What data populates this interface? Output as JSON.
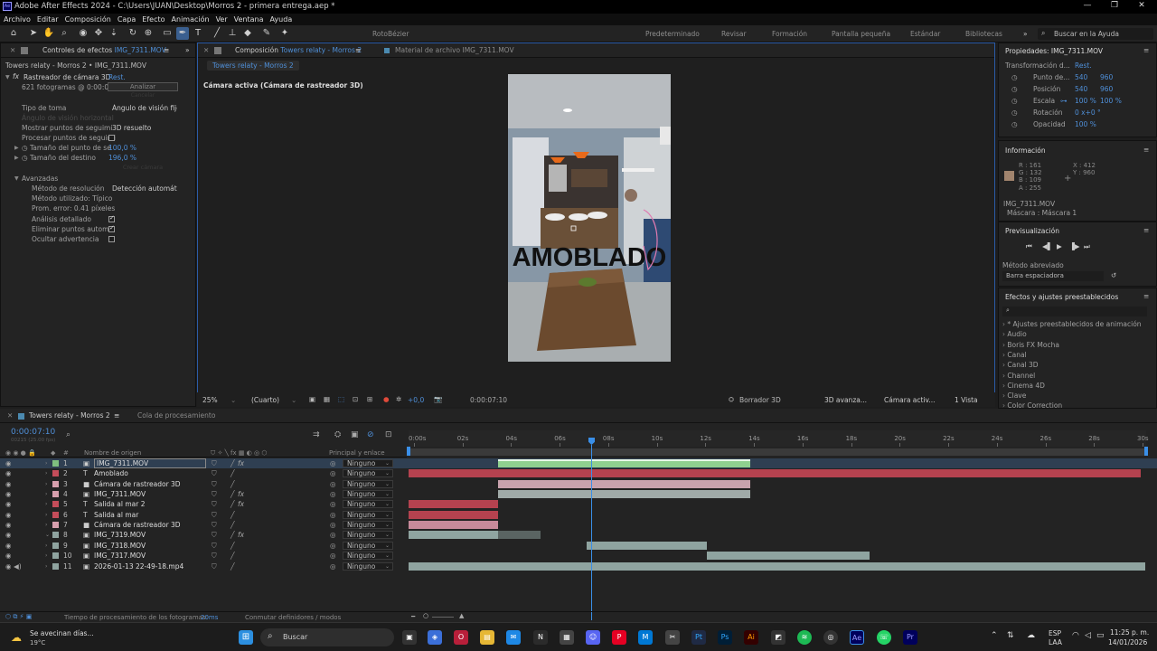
{
  "titlebar": {
    "title": "Adobe After Effects 2024 - C:\\Users\\JUAN\\Desktop\\Morros 2 - primera entrega.aep *",
    "minimize": "—",
    "maximize": "❐",
    "close": "✕"
  },
  "menu": [
    "Archivo",
    "Editar",
    "Composición",
    "Capa",
    "Efecto",
    "Animación",
    "Ver",
    "Ventana",
    "Ayuda"
  ],
  "toolbar": {
    "rotobezier": "RotoBézier",
    "workspaces": [
      "Predeterminado",
      "Revisar",
      "Formación",
      "Pantalla pequeña",
      "Estándar",
      "Bibliotecas"
    ],
    "search_placeholder": "Buscar en la Ayuda"
  },
  "effects_panel": {
    "tab_label": "Controles de efectos",
    "tab_file": "IMG_7311.MOV",
    "layer_path": "Towers relaty - Morros 2 • IMG_7311.MOV",
    "effect_name": "Rastreador de cámara 3D",
    "reset": "Rest.",
    "frames": "621 fotogramas @ 0:00:00:",
    "analyze": "Analizar",
    "cancel": "Cancelar",
    "shot_type_label": "Tipo de toma",
    "shot_type_value": "Ángulo de visión fijo",
    "fov_label": "Ángulo de visión horizontal",
    "show_track_label": "Mostrar puntos de seguimi",
    "show_track_value": "3D resuelto",
    "process_label": "Procesar puntos de seguimi",
    "track_size_label": "Tamaño del punto de se",
    "track_size_value": "100,0 %",
    "target_size_label": "Tamaño del destino",
    "target_size_value": "196,0 %",
    "create_camera": "Crear cámara",
    "advanced": "Avanzadas",
    "solve_method_label": "Método de resolución",
    "solve_method_value": "Detección automática",
    "method_used": "Método utilizado: Típico",
    "avg_error": "Prom. error: 0.41 píxeles",
    "detailed_label": "Análisis detallado",
    "auto_delete_label": "Eliminar puntos autom.",
    "hide_warning_label": "Ocultar advertencia"
  },
  "comp_panel": {
    "tab_label": "Composición",
    "tab_comp": "Towers relaty - Morros 2",
    "footage_tab": "Material de archivo IMG_7311.MOV",
    "breadcrumb": "Towers relaty - Morros 2",
    "camera_label": "Cámara activa (Cámara de rastreador 3D)",
    "overlay_text": "AMOBLADO",
    "zoom": "25%",
    "resolution": "(Cuarto)",
    "exposure": "+0,0",
    "timecode": "0:00:07:10",
    "draft": "Borrador 3D",
    "renderer": "3D avanza...",
    "camera": "Cámara activ...",
    "views": "1 Vista"
  },
  "properties": {
    "title": "Propiedades: IMG_7311.MOV",
    "transform": "Transformación d...",
    "reset": "Rest.",
    "rows": [
      {
        "label": "Punto de...",
        "v1": "540",
        "v2": "960"
      },
      {
        "label": "Posición",
        "v1": "540",
        "v2": "960"
      },
      {
        "label": "Escala",
        "v1": "100 %",
        "v2": "100 %"
      },
      {
        "label": "Rotación",
        "v1": "0 x+0 °",
        "v2": ""
      },
      {
        "label": "Opacidad",
        "v1": "100 %",
        "v2": ""
      }
    ]
  },
  "info": {
    "title": "Información",
    "r": "R : 161",
    "g": "G : 132",
    "b": "B : 109",
    "a": "A : 255",
    "x": "X : 412",
    "y": "Y : 960",
    "swatch": "#a1846d",
    "file": "IMG_7311.MOV",
    "mask": "Máscara : Máscara 1"
  },
  "preview": {
    "title": "Previsualización",
    "method_label": "Método abreviado",
    "method_value": "Barra espaciadora"
  },
  "presets": {
    "title": "Efectos y ajustes preestablecidos",
    "items": [
      "* Ajustes preestablecidos de animación",
      "Audio",
      "Boris FX Mocha",
      "Canal",
      "Canal 3D",
      "Channel",
      "Cinema 4D",
      "Clave",
      "Color Correction"
    ]
  },
  "timeline": {
    "tab_label": "Towers relaty - Morros 2",
    "queue_tab": "Cola de procesamiento",
    "timecode": "0:00:07:10",
    "fps": "00215 (25.00 fps)",
    "col_source": "Nombre de origen",
    "col_parent": "Principal y enlace",
    "col_num": "#",
    "ruler": [
      "0:00s",
      "02s",
      "04s",
      "06s",
      "08s",
      "10s",
      "12s",
      "14s",
      "16s",
      "18s",
      "20s",
      "22s",
      "24s",
      "26s",
      "28s",
      "30s"
    ],
    "layers": [
      {
        "num": "1",
        "icon": "▣",
        "name": "IMG_7311.MOV",
        "color": "#7fbf7f",
        "parent": "Ninguno",
        "fx": "fx"
      },
      {
        "num": "2",
        "icon": "T",
        "name": "Amoblado",
        "color": "#c44d5a",
        "parent": "Ninguno",
        "fx": ""
      },
      {
        "num": "3",
        "icon": "■",
        "name": "Cámara de rastreador 3D",
        "color": "#d7a0ae",
        "parent": "Ninguno",
        "fx": ""
      },
      {
        "num": "4",
        "icon": "▣",
        "name": "IMG_7311.MOV",
        "color": "#d7a0ae",
        "parent": "Ninguno",
        "fx": "fx"
      },
      {
        "num": "5",
        "icon": "T",
        "name": "Salida al mar 2",
        "color": "#c44d5a",
        "parent": "Ninguno",
        "fx": "fx"
      },
      {
        "num": "6",
        "icon": "T",
        "name": "Salida al mar",
        "color": "#c44d5a",
        "parent": "Ninguno",
        "fx": ""
      },
      {
        "num": "7",
        "icon": "■",
        "name": "Cámara de rastreador 3D",
        "color": "#d7a0ae",
        "parent": "Ninguno",
        "fx": ""
      },
      {
        "num": "8",
        "icon": "▣",
        "name": "IMG_7319.MOV",
        "color": "#8fa4a0",
        "parent": "Ninguno",
        "fx": "fx"
      },
      {
        "num": "9",
        "icon": "▣",
        "name": "IMG_7318.MOV",
        "color": "#8fa4a0",
        "parent": "Ninguno",
        "fx": ""
      },
      {
        "num": "10",
        "icon": "▣",
        "name": "IMG_7317.MOV",
        "color": "#8fa4a0",
        "parent": "Ninguno",
        "fx": ""
      },
      {
        "num": "11",
        "icon": "▣",
        "name": "2026-01-13 22-49-18.mp4",
        "color": "#8fa4a0",
        "parent": "Ninguno",
        "fx": ""
      }
    ],
    "render_time_label": "Tiempo de procesamiento de los fotogramas:",
    "render_time_value": "20ms",
    "toggle_label": "Conmutar definidores / modos"
  },
  "taskbar": {
    "weather_title": "Se avecinan días...",
    "weather_temp": "19°C",
    "search": "Buscar",
    "lang1": "ESP",
    "lang2": "LAA",
    "time": "11:25 p. m.",
    "date": "14/01/2026"
  },
  "colors": {
    "accent": "#4f8fd8",
    "playhead": "#3a8fe8"
  }
}
